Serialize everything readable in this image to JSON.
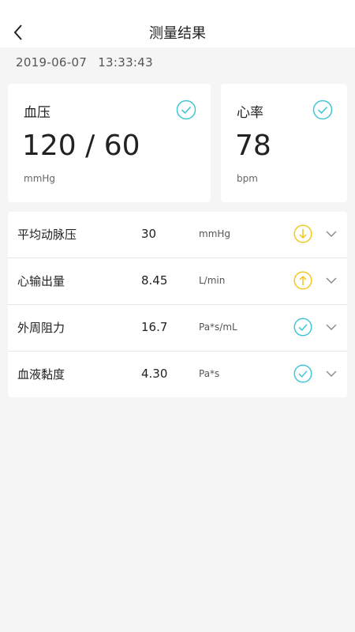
{
  "header": {
    "title": "测量结果"
  },
  "datetime": {
    "date": "2019-06-07",
    "time": "13:33:43"
  },
  "cards": {
    "blood_pressure": {
      "label": "血压",
      "value": "120 / 60",
      "unit": "mmHg",
      "status_icon": "check-circle-icon"
    },
    "heart_rate": {
      "label": "心率",
      "value": "78",
      "unit": "bpm",
      "status_icon": "check-circle-icon"
    }
  },
  "metrics": [
    {
      "name": "平均动脉压",
      "value": "30",
      "unit": "mmHg",
      "status": "low",
      "status_icon": "arrow-down-circle-icon"
    },
    {
      "name": "心输出量",
      "value": "8.45",
      "unit": "L/min",
      "status": "high",
      "status_icon": "arrow-up-circle-icon"
    },
    {
      "name": "外周阻力",
      "value": "16.7",
      "unit": "Pa*s/mL",
      "status": "normal",
      "status_icon": "check-circle-icon"
    },
    {
      "name": "血液黏度",
      "value": "4.30",
      "unit": "Pa*s",
      "status": "normal",
      "status_icon": "check-circle-icon"
    }
  ],
  "colors": {
    "normal": "#3fc6d6",
    "warning": "#f2c81e",
    "background": "#f5f5f5",
    "card": "#ffffff"
  }
}
